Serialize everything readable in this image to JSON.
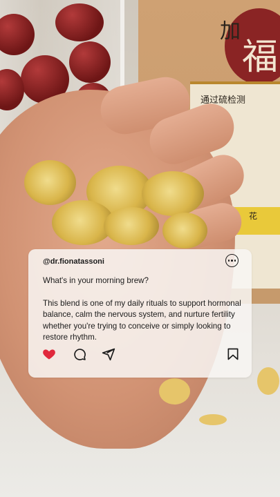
{
  "post": {
    "handle": "@dr.fionatassoni",
    "caption_line1": "What's in your morning brew?",
    "caption_line2": "This blend is one of my daily rituals to support hormonal balance, calm the nervous system, and nurture fertility whether you're trying to conceive or simply looking to restore rhythm.",
    "liked": true
  },
  "icons": {
    "more": "more-options-icon",
    "like": "heart-icon",
    "comment": "comment-icon",
    "share": "send-icon",
    "save": "bookmark-icon"
  },
  "colors": {
    "like_active": "#e0283c",
    "icon": "#1b1b1b",
    "card_background": "#f8f6f3"
  },
  "package": {
    "label_line1": "加",
    "label_line2": "福",
    "label_line3": "通过硫检测",
    "label_line4": "花"
  }
}
